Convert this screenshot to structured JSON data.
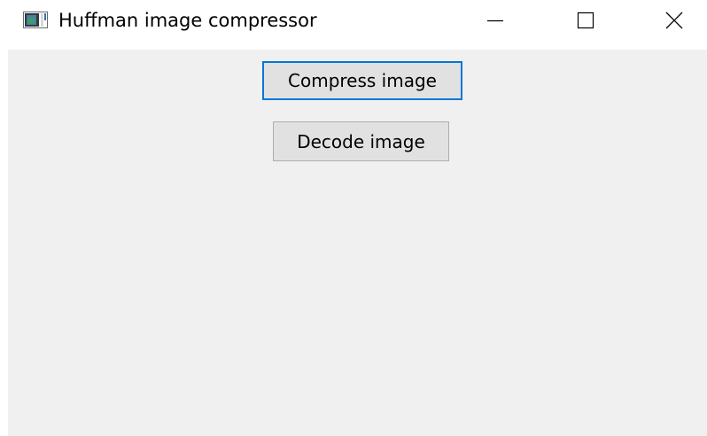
{
  "window": {
    "title": "Huffman image compressor",
    "app_icon": "window-app-icon",
    "controls": {
      "minimize_icon": "minimize-icon",
      "maximize_icon": "maximize-icon",
      "close_icon": "close-icon"
    }
  },
  "main": {
    "compress_label": "Compress image",
    "decode_label": "Decode image",
    "focused_button": "compress"
  },
  "colors": {
    "client_background": "#f0f0f0",
    "button_face": "#e1e1e1",
    "button_border": "#adadad",
    "focus_accent": "#0078d7"
  }
}
